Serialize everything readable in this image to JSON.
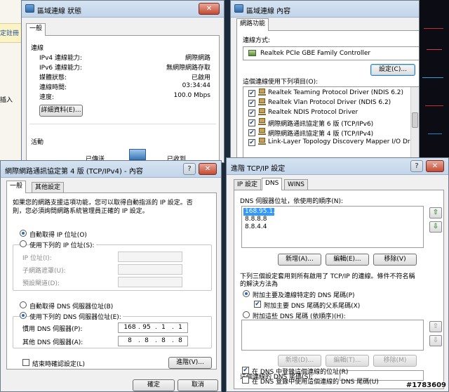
{
  "watermark": "#1783609",
  "background": {
    "left_strip": [
      "定註冊",
      "插入"
    ]
  },
  "status_window": {
    "title": "區域連線 狀態",
    "tab": "一般",
    "connection_header": "連線",
    "rows": [
      {
        "label": "IPv4 連線能力:",
        "value": "網際網路"
      },
      {
        "label": "IPv6 連線能力:",
        "value": "無網際網路存取"
      },
      {
        "label": "媒體狀態:",
        "value": "已啟用"
      },
      {
        "label": "連線時間:",
        "value": "03:34:44"
      },
      {
        "label": "速度:",
        "value": "100.0 Mbps"
      }
    ],
    "details_button": "詳細資料(E)...",
    "activity_header": "活動",
    "sent_label": "已傳送",
    "recv_label": "已收到"
  },
  "props_window": {
    "title": "區域連線 內容",
    "tab": "網路功能",
    "connect_using_label": "連線方式:",
    "adapter": "Realtek PCIe GBE Family Controller",
    "configure_button": "設定(C)...",
    "items_label": "這個連線使用下列項目(O):",
    "items": [
      "Realtek Teaming Protocol Driver (NDIS 6.2)",
      "Realtek Vlan Protocol Driver (NDIS 6.2)",
      "Realtek NDIS Protocol Driver",
      "網際網路通訊協定第 6 版 (TCP/IPv6)",
      "網際網路通訊協定第 4 版 (TCP/IPv4)",
      "Link-Layer Topology Discovery Mapper I/O Driver"
    ]
  },
  "ipv4_window": {
    "title": "網際網路通訊協定第 4 版 (TCP/IPv4) - 內容",
    "tabs": [
      "一般",
      "其他設定"
    ],
    "intro_line1": "如果您的網路支援這項功能，您可以取得自動指派的 IP 設定。否",
    "intro_line2": "則，您必須詢問網路系統管理員正確的 IP 設定。",
    "auto_ip": "自動取得 IP 位址(O)",
    "manual_ip": "使用下列的 IP 位址(S):",
    "ip_label": "IP 位址(I):",
    "mask_label": "子網路遮罩(U):",
    "gateway_label": "預設閘道(D):",
    "auto_dns": "自動取得 DNS 伺服器位址(B)",
    "manual_dns": "使用下列的 DNS 伺服器位址(E):",
    "preferred_dns_label": "慣用 DNS 伺服器(P):",
    "preferred_dns": [
      "168",
      "95",
      "1",
      "1"
    ],
    "alternate_dns_label": "其他 DNS 伺服器(A):",
    "alternate_dns": [
      "8",
      "8",
      "8",
      "8"
    ],
    "validate_on_exit": "結束時確認設定(L)",
    "advanced_button": "進階(V)...",
    "ok_button": "確定",
    "cancel_button": "取消"
  },
  "advanced_window": {
    "title": "進階 TCP/IP 設定",
    "tabs": [
      "IP 設定",
      "DNS",
      "WINS"
    ],
    "dns_list_label": "DNS 伺服器位址，依使用的順序(N):",
    "dns_servers": [
      "168.95.1.1",
      "8.8.8.8",
      "8.8.4.4"
    ],
    "add_button": "新增(A)...",
    "edit_button": "編輯(E)...",
    "remove_button": "移除(V)",
    "suffix_info_line1": "下列三個設定套用到所有啟用了 TCP/IP 的連線。條件不符名稱",
    "suffix_info_line2": "的解決方法為",
    "append_primary": "附加主要及連線特定的 DNS 尾碼(P)",
    "append_parent": "附加主要 DNS 尾碼的父系尾碼(X)",
    "append_these": "附加這些 DNS 尾碼 (依順序)(H):",
    "add_button2": "新增(D)...",
    "edit_button2": "編輯(T)...",
    "remove_button2": "移除(M)",
    "conn_suffix_label": "這個連線的 DNS 尾碼(S):",
    "register_address": "在 DNS 中登錄這個連線的位址(R)",
    "use_suffix_register": "在 DNS 登錄中使用這個連線的 DNS 尾碼(U)"
  }
}
